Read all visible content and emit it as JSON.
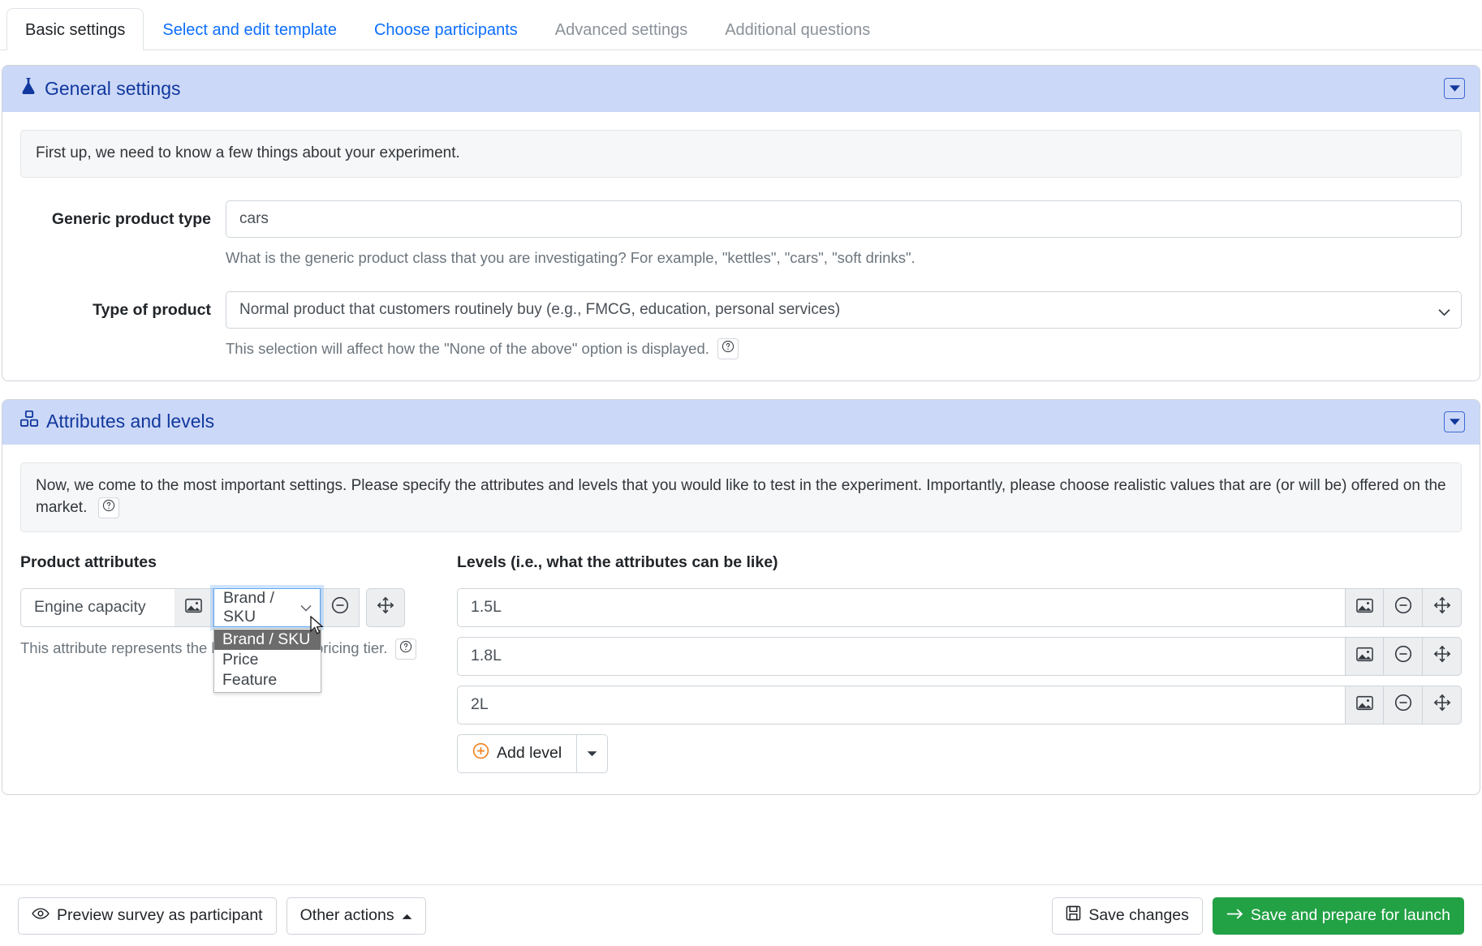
{
  "tabs": [
    {
      "label": "Basic settings",
      "state": "active"
    },
    {
      "label": "Select and edit template",
      "state": "link"
    },
    {
      "label": "Choose participants",
      "state": "link"
    },
    {
      "label": "Advanced settings",
      "state": "disabled"
    },
    {
      "label": "Additional questions",
      "state": "disabled"
    }
  ],
  "general_settings": {
    "title": "General settings",
    "icon": "flask-icon",
    "collapse_icon": "caret-down-square-icon",
    "notice": "First up, we need to know a few things about your experiment.",
    "generic_product_type": {
      "label": "Generic product type",
      "value": "cars",
      "placeholder": "",
      "help": "What is the generic product class that you are investigating? For example, \"kettles\", \"cars\", \"soft drinks\"."
    },
    "type_of_product": {
      "label": "Type of product",
      "value": "Normal product that customers routinely buy (e.g., FMCG, education, personal services)",
      "options": [
        "Normal product that customers routinely buy (e.g., FMCG, education, personal services)"
      ],
      "help": "This selection will affect how the \"None of the above\" option is displayed.",
      "help_icon": "question-circle-icon"
    }
  },
  "attributes_and_levels": {
    "title": "Attributes and levels",
    "icon": "boxes-icon",
    "collapse_icon": "caret-down-square-icon",
    "notice": "Now, we come to the most important settings. Please specify the attributes and levels that you would like to test in the experiment. Importantly, please choose realistic values that are (or will be) offered on the market.",
    "notice_icon": "question-circle-icon",
    "attributes_column_title": "Product attributes",
    "levels_column_title": "Levels (i.e., what the attributes can be like)",
    "attribute": {
      "name": "Engine capacity",
      "image_icon": "image-icon",
      "remove_icon": "minus-circle-icon",
      "move_icon": "arrows-move-icon",
      "type_select": {
        "value": "Brand / SKU",
        "open": true,
        "options": [
          "Brand / SKU",
          "Price",
          "Feature"
        ],
        "selected_option": "Brand / SKU"
      },
      "help": "This attribute represents the brand, SKU, or pricing tier.",
      "help_icon": "question-circle-icon"
    },
    "levels": [
      {
        "value": "1.5L",
        "image_icon": "image-icon",
        "remove_icon": "minus-circle-icon",
        "move_icon": "arrows-move-icon"
      },
      {
        "value": "1.8L",
        "image_icon": "image-icon",
        "remove_icon": "minus-circle-icon",
        "move_icon": "arrows-move-icon"
      },
      {
        "value": "2L",
        "image_icon": "image-icon",
        "remove_icon": "minus-circle-icon",
        "move_icon": "arrows-move-icon"
      }
    ],
    "add_level": {
      "label": "Add level",
      "icon": "plus-circle-icon",
      "split_icon": "caret-down-icon"
    }
  },
  "footer": {
    "preview": {
      "label": "Preview survey as participant",
      "icon": "eye-icon"
    },
    "other_actions": {
      "label": "Other actions",
      "icon": "caret-up-icon"
    },
    "save_changes": {
      "label": "Save changes",
      "icon": "save-icon"
    },
    "save_and_launch": {
      "label": "Save and prepare for launch",
      "icon": "arrow-right-icon"
    }
  },
  "colors": {
    "accent_blue": "#0d6efd",
    "header_bg": "#ccd8f7",
    "header_text": "#11389e",
    "green": "#23a145",
    "orange": "#f0821e"
  }
}
